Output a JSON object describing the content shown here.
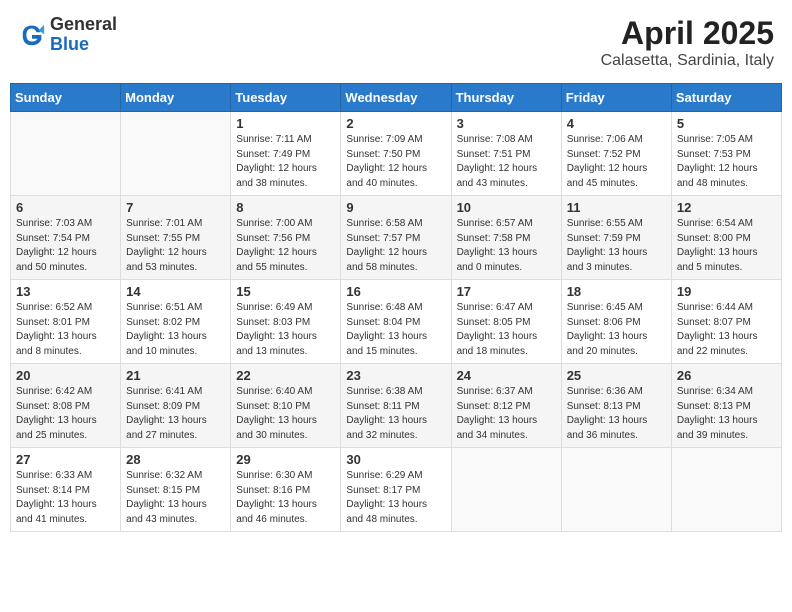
{
  "logo": {
    "general": "General",
    "blue": "Blue"
  },
  "title": "April 2025",
  "location": "Calasetta, Sardinia, Italy",
  "weekdays": [
    "Sunday",
    "Monday",
    "Tuesday",
    "Wednesday",
    "Thursday",
    "Friday",
    "Saturday"
  ],
  "weeks": [
    [
      {
        "day": "",
        "info": ""
      },
      {
        "day": "",
        "info": ""
      },
      {
        "day": "1",
        "info": "Sunrise: 7:11 AM\nSunset: 7:49 PM\nDaylight: 12 hours\nand 38 minutes."
      },
      {
        "day": "2",
        "info": "Sunrise: 7:09 AM\nSunset: 7:50 PM\nDaylight: 12 hours\nand 40 minutes."
      },
      {
        "day": "3",
        "info": "Sunrise: 7:08 AM\nSunset: 7:51 PM\nDaylight: 12 hours\nand 43 minutes."
      },
      {
        "day": "4",
        "info": "Sunrise: 7:06 AM\nSunset: 7:52 PM\nDaylight: 12 hours\nand 45 minutes."
      },
      {
        "day": "5",
        "info": "Sunrise: 7:05 AM\nSunset: 7:53 PM\nDaylight: 12 hours\nand 48 minutes."
      }
    ],
    [
      {
        "day": "6",
        "info": "Sunrise: 7:03 AM\nSunset: 7:54 PM\nDaylight: 12 hours\nand 50 minutes."
      },
      {
        "day": "7",
        "info": "Sunrise: 7:01 AM\nSunset: 7:55 PM\nDaylight: 12 hours\nand 53 minutes."
      },
      {
        "day": "8",
        "info": "Sunrise: 7:00 AM\nSunset: 7:56 PM\nDaylight: 12 hours\nand 55 minutes."
      },
      {
        "day": "9",
        "info": "Sunrise: 6:58 AM\nSunset: 7:57 PM\nDaylight: 12 hours\nand 58 minutes."
      },
      {
        "day": "10",
        "info": "Sunrise: 6:57 AM\nSunset: 7:58 PM\nDaylight: 13 hours\nand 0 minutes."
      },
      {
        "day": "11",
        "info": "Sunrise: 6:55 AM\nSunset: 7:59 PM\nDaylight: 13 hours\nand 3 minutes."
      },
      {
        "day": "12",
        "info": "Sunrise: 6:54 AM\nSunset: 8:00 PM\nDaylight: 13 hours\nand 5 minutes."
      }
    ],
    [
      {
        "day": "13",
        "info": "Sunrise: 6:52 AM\nSunset: 8:01 PM\nDaylight: 13 hours\nand 8 minutes."
      },
      {
        "day": "14",
        "info": "Sunrise: 6:51 AM\nSunset: 8:02 PM\nDaylight: 13 hours\nand 10 minutes."
      },
      {
        "day": "15",
        "info": "Sunrise: 6:49 AM\nSunset: 8:03 PM\nDaylight: 13 hours\nand 13 minutes."
      },
      {
        "day": "16",
        "info": "Sunrise: 6:48 AM\nSunset: 8:04 PM\nDaylight: 13 hours\nand 15 minutes."
      },
      {
        "day": "17",
        "info": "Sunrise: 6:47 AM\nSunset: 8:05 PM\nDaylight: 13 hours\nand 18 minutes."
      },
      {
        "day": "18",
        "info": "Sunrise: 6:45 AM\nSunset: 8:06 PM\nDaylight: 13 hours\nand 20 minutes."
      },
      {
        "day": "19",
        "info": "Sunrise: 6:44 AM\nSunset: 8:07 PM\nDaylight: 13 hours\nand 22 minutes."
      }
    ],
    [
      {
        "day": "20",
        "info": "Sunrise: 6:42 AM\nSunset: 8:08 PM\nDaylight: 13 hours\nand 25 minutes."
      },
      {
        "day": "21",
        "info": "Sunrise: 6:41 AM\nSunset: 8:09 PM\nDaylight: 13 hours\nand 27 minutes."
      },
      {
        "day": "22",
        "info": "Sunrise: 6:40 AM\nSunset: 8:10 PM\nDaylight: 13 hours\nand 30 minutes."
      },
      {
        "day": "23",
        "info": "Sunrise: 6:38 AM\nSunset: 8:11 PM\nDaylight: 13 hours\nand 32 minutes."
      },
      {
        "day": "24",
        "info": "Sunrise: 6:37 AM\nSunset: 8:12 PM\nDaylight: 13 hours\nand 34 minutes."
      },
      {
        "day": "25",
        "info": "Sunrise: 6:36 AM\nSunset: 8:13 PM\nDaylight: 13 hours\nand 36 minutes."
      },
      {
        "day": "26",
        "info": "Sunrise: 6:34 AM\nSunset: 8:13 PM\nDaylight: 13 hours\nand 39 minutes."
      }
    ],
    [
      {
        "day": "27",
        "info": "Sunrise: 6:33 AM\nSunset: 8:14 PM\nDaylight: 13 hours\nand 41 minutes."
      },
      {
        "day": "28",
        "info": "Sunrise: 6:32 AM\nSunset: 8:15 PM\nDaylight: 13 hours\nand 43 minutes."
      },
      {
        "day": "29",
        "info": "Sunrise: 6:30 AM\nSunset: 8:16 PM\nDaylight: 13 hours\nand 46 minutes."
      },
      {
        "day": "30",
        "info": "Sunrise: 6:29 AM\nSunset: 8:17 PM\nDaylight: 13 hours\nand 48 minutes."
      },
      {
        "day": "",
        "info": ""
      },
      {
        "day": "",
        "info": ""
      },
      {
        "day": "",
        "info": ""
      }
    ]
  ]
}
